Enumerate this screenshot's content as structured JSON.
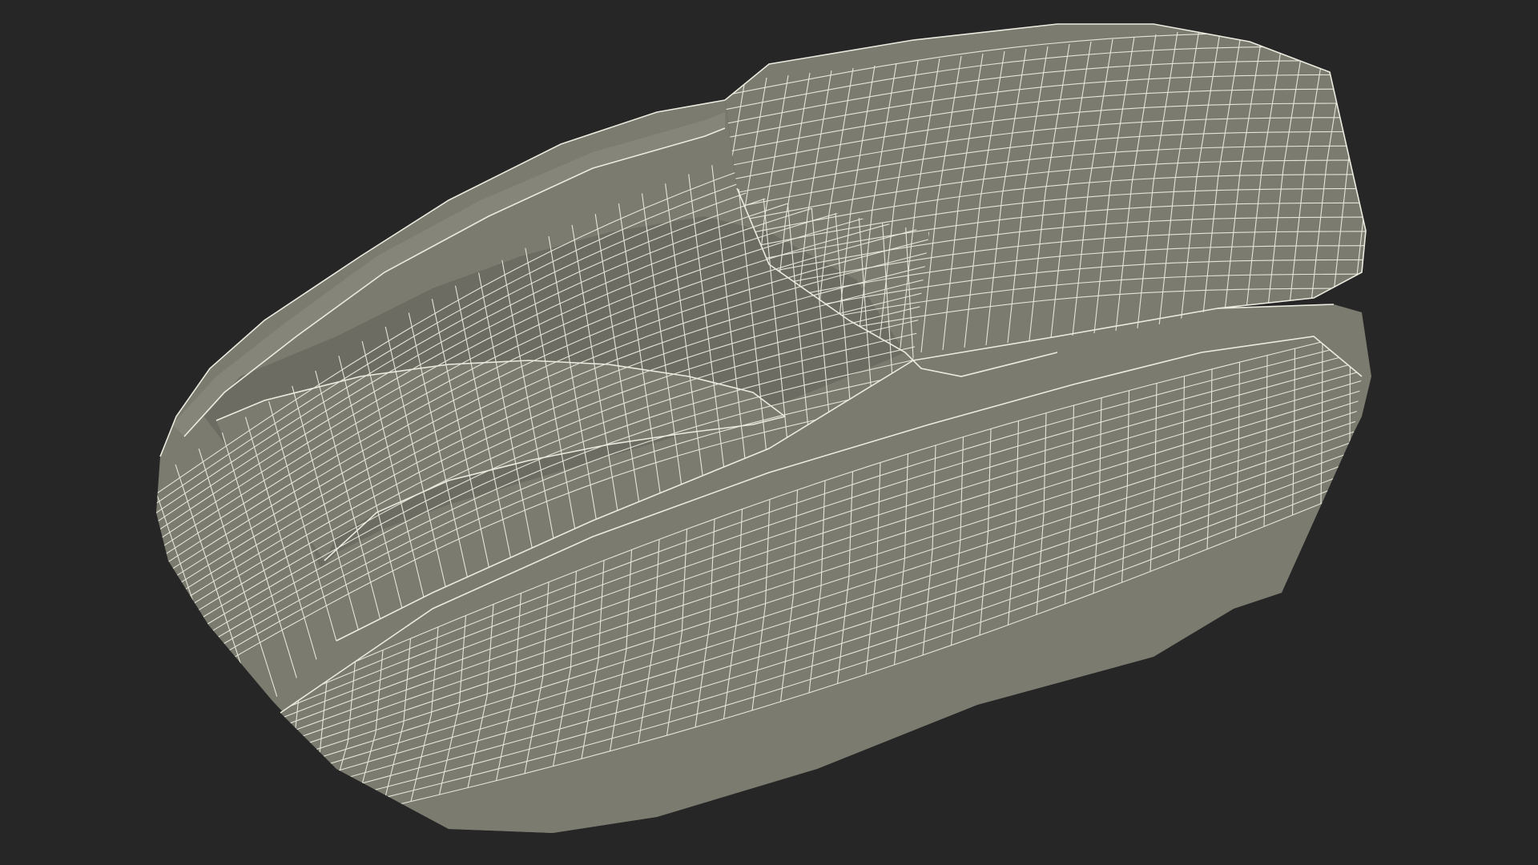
{
  "viewport": {
    "background_color": "#262626",
    "mode": "wireframe-on-shaded"
  },
  "model": {
    "shading_color": "#7b7b70",
    "shadow_color": "#6c6c62",
    "highlight_color": "#85857a",
    "wire_color": "#ecebe0"
  }
}
